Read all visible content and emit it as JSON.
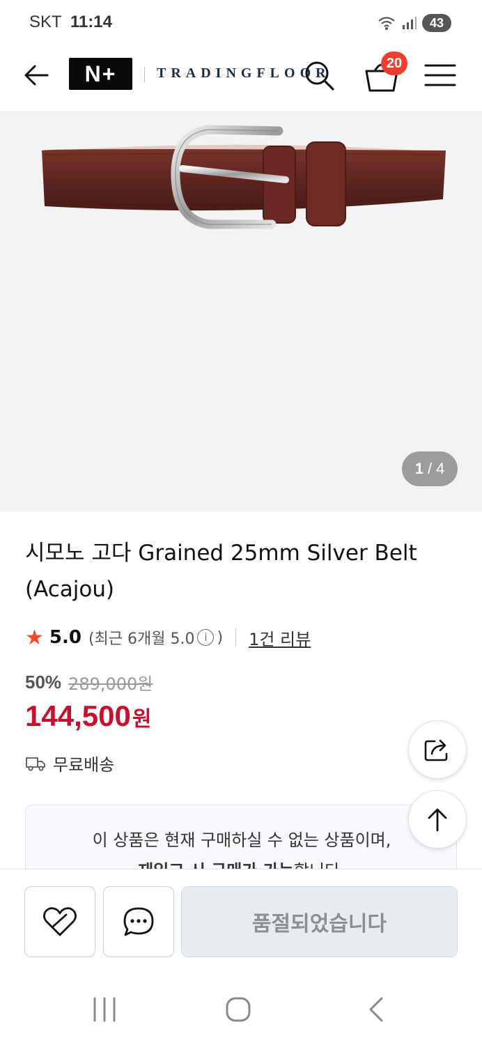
{
  "status_bar": {
    "carrier": "SKT",
    "time": "11:14",
    "battery": "43"
  },
  "header": {
    "logo_mark": "N+",
    "logo_text": "TRADINGFLOOR",
    "cart_count": "20",
    "icons": [
      "back-arrow-icon",
      "search-icon",
      "cart-icon",
      "hamburger-menu-icon"
    ]
  },
  "gallery": {
    "current_page": "1",
    "separator": "/",
    "total_pages": "4"
  },
  "product": {
    "title": "시모노 고다 Grained 25mm Silver Belt (Acajou)",
    "rating_score": "5.0",
    "rating_recent_prefix": "(최근 6개월 5.0",
    "rating_recent_suffix": ")",
    "info_icon_glyph": "i",
    "review_count": "1건 리뷰",
    "discount_rate": "50%",
    "original_price": "289,000원",
    "sale_price": "144,500",
    "sale_currency": "원",
    "shipping": "무료배송"
  },
  "notice": {
    "line1": "이 상품은 현재 구매하실 수 없는 상품이며,",
    "line2_bold": "재입고 시 구매가 가능",
    "line2_rest": "합니다."
  },
  "actions": {
    "soldout_label": "품절되었습니다"
  },
  "colors": {
    "sale_price": "#c8102e",
    "star": "#f04a2c",
    "cart_badge": "#ef3d2f",
    "belt_leather": "#6b2a24",
    "soldout_bg": "#e9ecef"
  }
}
